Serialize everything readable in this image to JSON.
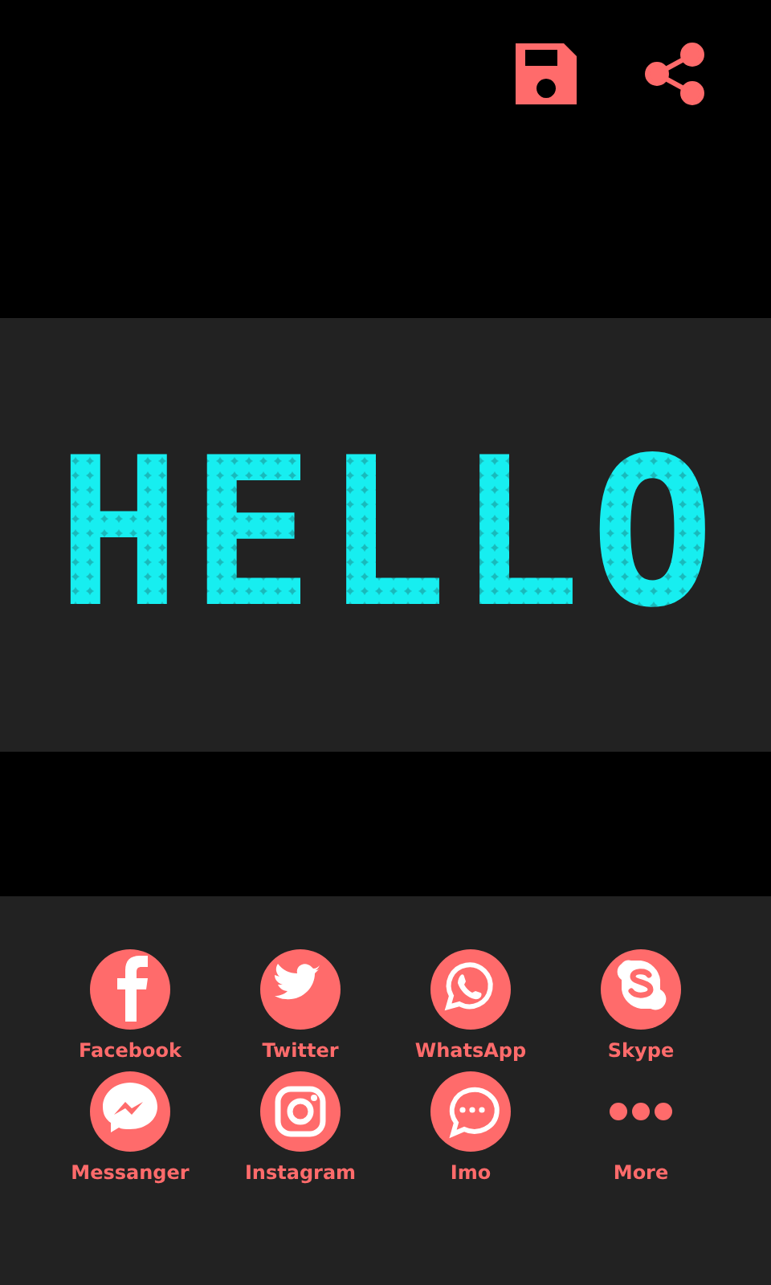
{
  "toolbar": {
    "actions": [
      {
        "kind": "save"
      },
      {
        "kind": "share"
      }
    ]
  },
  "display": {
    "text": "HELLO"
  },
  "share_targets": [
    {
      "kind": "facebook",
      "label": "Facebook"
    },
    {
      "kind": "twitter",
      "label": "Twitter"
    },
    {
      "kind": "whatsapp",
      "label": "WhatsApp"
    },
    {
      "kind": "skype",
      "label": "Skype"
    },
    {
      "kind": "messenger",
      "label": "Messanger"
    },
    {
      "kind": "instagram",
      "label": "Instagram"
    },
    {
      "kind": "imo",
      "label": "Imo"
    },
    {
      "kind": "more",
      "label": "More"
    }
  ]
}
